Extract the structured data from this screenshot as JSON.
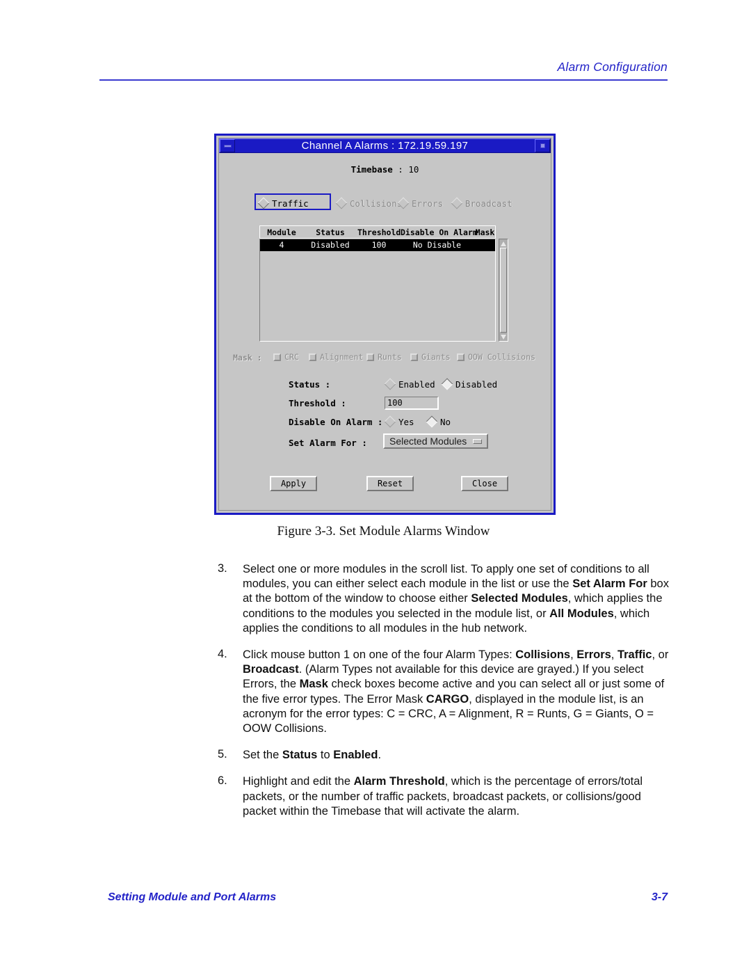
{
  "running_head": "Alarm Configuration",
  "figure": {
    "window": {
      "title": "Channel A Alarms : 172.19.59.197",
      "min_button": "minimize",
      "max_button": "maximize",
      "timebase_label": "Timebase",
      "timebase_sep": " : ",
      "timebase_value": "10",
      "alarm_types": [
        {
          "label": "Traffic",
          "selected": true,
          "enabled": true,
          "focused": true
        },
        {
          "label": "Collisions",
          "selected": false,
          "enabled": false,
          "focused": false
        },
        {
          "label": "Errors",
          "selected": false,
          "enabled": false,
          "focused": false
        },
        {
          "label": "Broadcast",
          "selected": false,
          "enabled": false,
          "focused": false
        }
      ],
      "table": {
        "columns": [
          "Module",
          "Status",
          "Threshold",
          "Disable On Alarm",
          "Mask"
        ],
        "rows": [
          {
            "module": "4",
            "status": "Disabled",
            "threshold": "100",
            "disable_on_alarm": "No Disable",
            "mask": "",
            "selected": true
          }
        ]
      },
      "mask": {
        "label": "Mask :",
        "items": [
          {
            "label": "CRC",
            "checked": false
          },
          {
            "label": "Alignment",
            "checked": false
          },
          {
            "label": "Runts",
            "checked": false
          },
          {
            "label": "Giants",
            "checked": false
          },
          {
            "label": "OOW Collisions",
            "checked": false
          }
        ]
      },
      "status": {
        "label": "Status :",
        "options": [
          {
            "label": "Enabled",
            "selected": false
          },
          {
            "label": "Disabled",
            "selected": true
          }
        ]
      },
      "threshold": {
        "label": "Threshold :",
        "value": "100"
      },
      "disable_on_alarm": {
        "label": "Disable On Alarm :",
        "options": [
          {
            "label": "Yes",
            "selected": false
          },
          {
            "label": "No",
            "selected": true
          }
        ]
      },
      "set_alarm_for": {
        "label": "Set Alarm For :",
        "value": "Selected Modules"
      },
      "buttons": [
        {
          "label": "Apply"
        },
        {
          "label": "Reset"
        },
        {
          "label": "Close"
        }
      ]
    },
    "caption": "Figure 3-3.  Set Module Alarms Window"
  },
  "steps": [
    {
      "num": "3.",
      "html": "Select one or more modules in the scroll list. To apply one set of conditions to all modules, you can either select each module in the list or use the <b>Set Alarm For</b> box at the bottom of the window to choose either <b>Selected Modules</b>, which applies the conditions to the modules you selected in the module list, or <b>All Modules</b>, which applies the conditions to all modules in the hub network."
    },
    {
      "num": "4.",
      "html": "Click mouse button 1 on one of the four Alarm Types: <b>Collisions</b>, <b>Errors</b>, <b>Traffic</b>, or <b>Broadcast</b>. (Alarm Types not available for this device are grayed.) If you select Errors, the <b>Mask</b> check boxes become active and you can select all or just some of the five error types. The Error Mask <b>CARGO</b>, displayed in the module list, is an acronym for the error types: C = CRC, A = Alignment, R = Runts, G = Giants, O = OOW Collisions."
    },
    {
      "num": "5.",
      "html": "Set the <b>Status</b> to <b>Enabled</b>."
    },
    {
      "num": "6.",
      "html": "Highlight and edit the <b>Alarm Threshold</b>, which is the percentage of errors/total packets, or the number of traffic packets, broadcast packets, or collisions/good packet within the Timebase that will activate the alarm."
    }
  ],
  "footer": {
    "left": "Setting Module and Port Alarms",
    "page": "3-7"
  },
  "colors": {
    "accent_blue": "#2323c8",
    "window_border": "#1a1ac4",
    "face_gray": "#c6c6c6",
    "selection_black": "#000000",
    "disabled_gray": "#8e8e8e"
  }
}
